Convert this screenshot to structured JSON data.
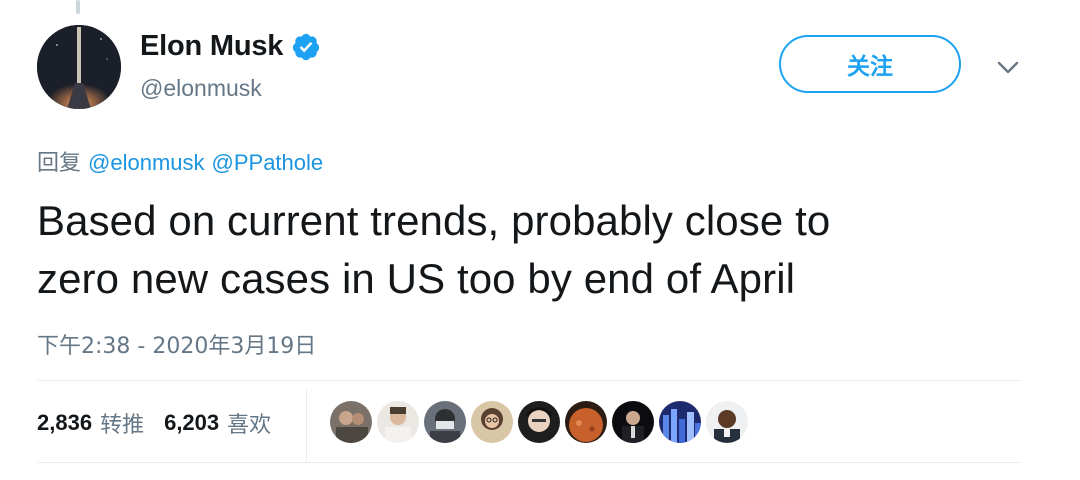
{
  "author": {
    "display_name": "Elon Musk",
    "handle": "@elonmusk",
    "verified": true
  },
  "follow_label": "关注",
  "reply": {
    "prefix": "回复",
    "mentions": [
      "@elonmusk",
      "@PPathole"
    ]
  },
  "tweet": {
    "text_line1": "Based on current trends, probably close to",
    "text_line2": "zero new cases in US too by end of April",
    "timestamp": "下午2:38 - 2020年3月19日"
  },
  "stats": {
    "retweets_count": "2,836",
    "retweets_label": "转推",
    "likes_count": "6,203",
    "likes_label": "喜欢"
  },
  "likers": [
    {
      "icon": "liker-avatar-1"
    },
    {
      "icon": "liker-avatar-2"
    },
    {
      "icon": "liker-avatar-3"
    },
    {
      "icon": "liker-avatar-4"
    },
    {
      "icon": "liker-avatar-5"
    },
    {
      "icon": "liker-avatar-6"
    },
    {
      "icon": "liker-avatar-7"
    },
    {
      "icon": "liker-avatar-8"
    },
    {
      "icon": "liker-avatar-9"
    }
  ],
  "colors": {
    "accent": "#1da1f2",
    "link": "#1b95e0",
    "text": "#14171a",
    "secondary": "#657786",
    "divider": "#e6ecf0"
  }
}
